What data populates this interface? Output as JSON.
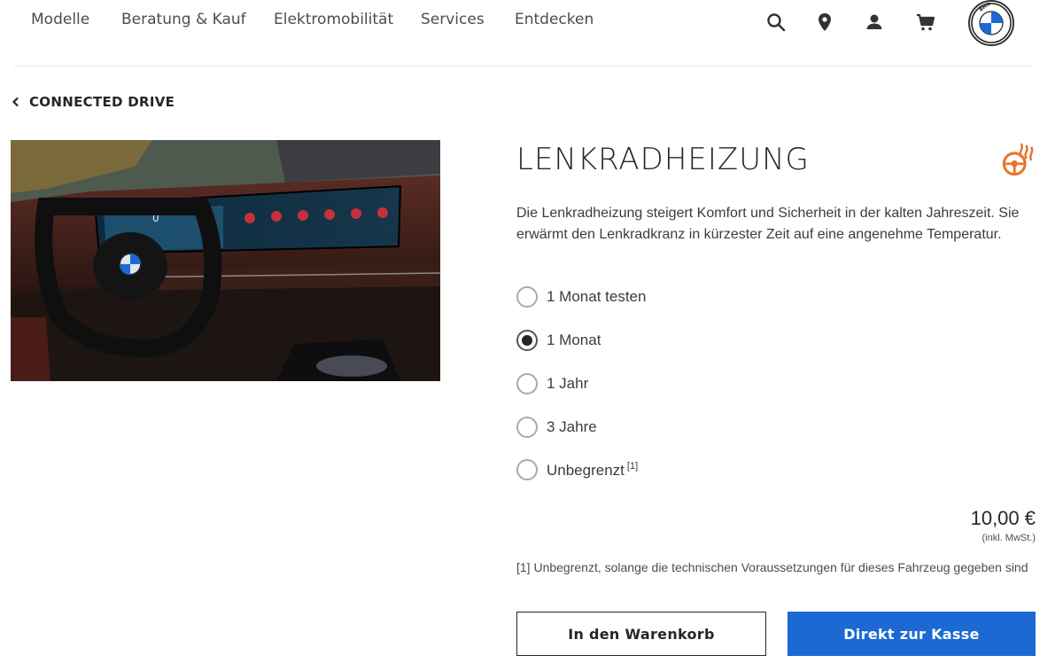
{
  "nav": {
    "items": [
      "Modelle",
      "Beratung & Kauf",
      "Elektromobilität",
      "Services",
      "Entdecken"
    ],
    "logo_letters": "BMW"
  },
  "breadcrumb": {
    "back_label": "CONNECTED DRIVE"
  },
  "product": {
    "title": "LENKRADHEIZUNG",
    "description": "Die Lenkradheizung steigert Komfort und Sicherheit in der kalten Jahreszeit. Sie erwärmt den Lenkradkranz in kürzester Zeit auf eine angenehme Temperatur.",
    "options": [
      {
        "label": "1 Monat testen",
        "sup": "",
        "checked": false
      },
      {
        "label": "1 Monat",
        "sup": "",
        "checked": true
      },
      {
        "label": "1 Jahr",
        "sup": "",
        "checked": false
      },
      {
        "label": "3 Jahre",
        "sup": "",
        "checked": false
      },
      {
        "label": "Unbegrenzt",
        "sup": "[1]",
        "checked": false
      }
    ],
    "price": "10,00 €",
    "tax_note": "(inkl. MwSt.)",
    "footnote": "[1] Unbegrenzt, solange die technischen Voraussetzungen für dieses Fahrzeug gegeben sind",
    "icon": "heated-steering-wheel-icon"
  },
  "actions": {
    "cart_label": "In den Warenkorb",
    "checkout_label": "Direkt zur Kasse"
  },
  "colors": {
    "accent": "#1c69d3",
    "feature_icon": "#e8742b",
    "text": "#262626"
  }
}
